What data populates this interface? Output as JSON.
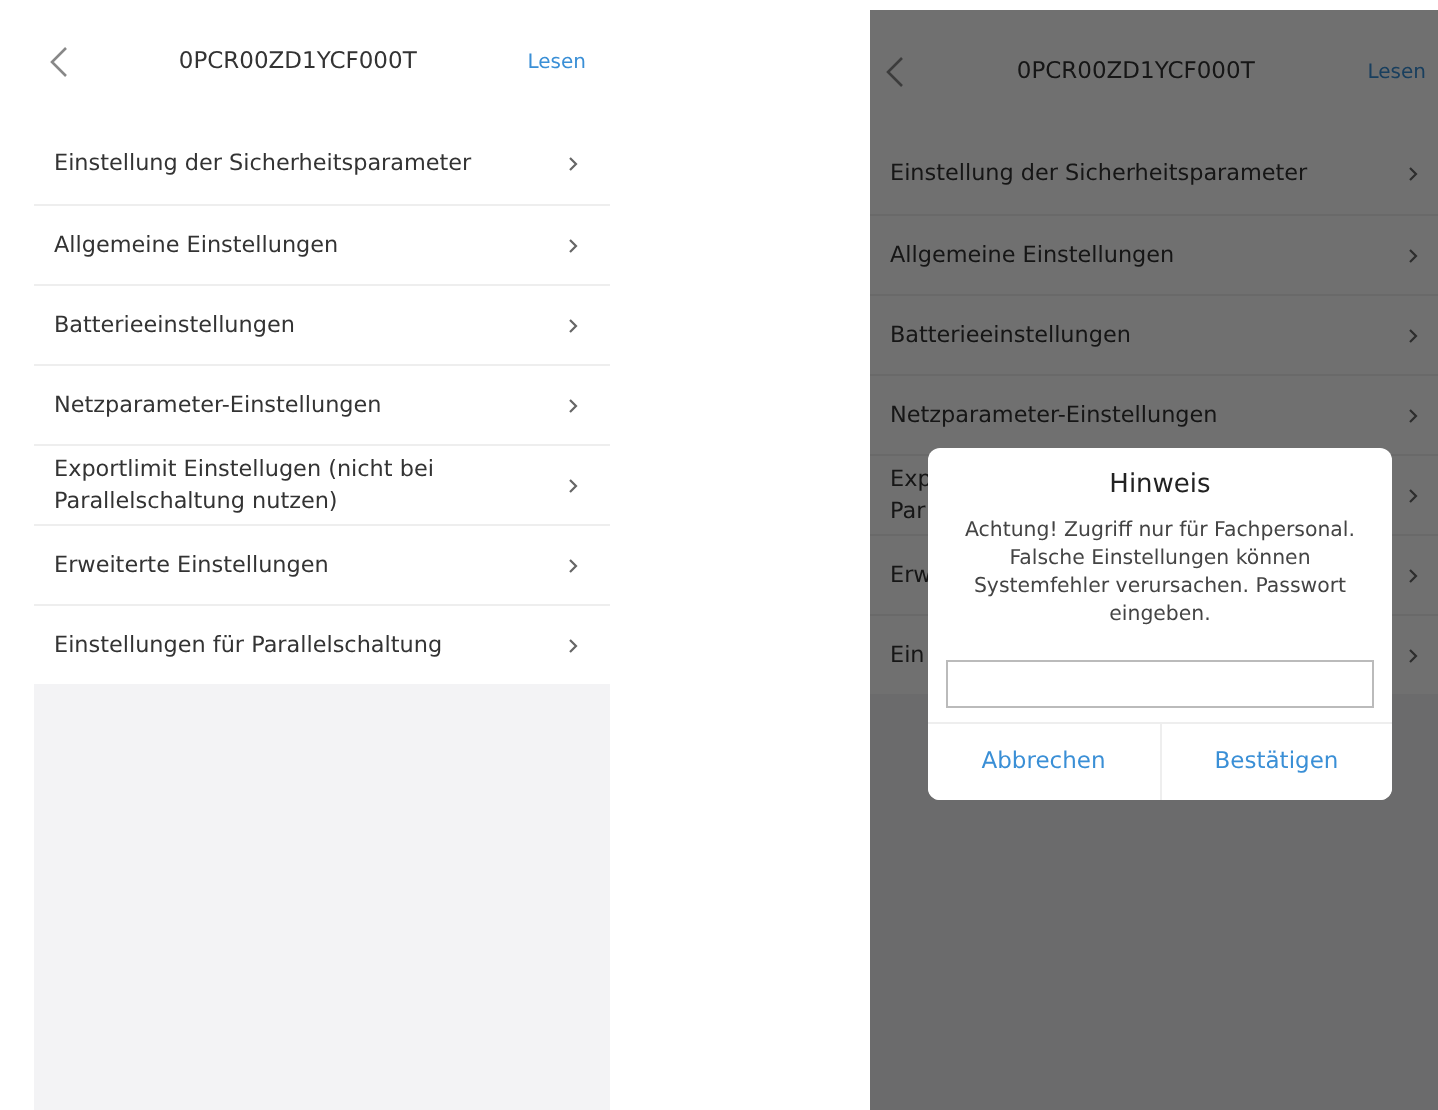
{
  "screens": [
    {
      "header": {
        "title": "0PCR00ZD1YCF000T",
        "action": "Lesen"
      },
      "items": [
        {
          "lines": [
            "Einstellung der Sicherheitsparameter"
          ]
        },
        {
          "lines": [
            "Allgemeine Einstellungen"
          ]
        },
        {
          "lines": [
            "Batterieeinstellungen"
          ]
        },
        {
          "lines": [
            "Netzparameter-Einstellungen"
          ]
        },
        {
          "lines": [
            "Exportlimit Einstellugen (nicht bei",
            "Parallelschaltung nutzen)"
          ]
        },
        {
          "lines": [
            "Erweiterte Einstellungen"
          ]
        },
        {
          "lines": [
            "Einstellungen für Parallelschaltung"
          ]
        }
      ]
    },
    {
      "header": {
        "title": "0PCR00ZD1YCF000T",
        "action": "Lesen"
      },
      "items": [
        {
          "lines": [
            "Einstellung der Sicherheitsparameter"
          ]
        },
        {
          "lines": [
            "Allgemeine Einstellungen"
          ]
        },
        {
          "lines": [
            "Batterieeinstellungen"
          ]
        },
        {
          "lines": [
            "Netzparameter-Einstellungen"
          ]
        },
        {
          "lines": [
            "Exp",
            "Par"
          ]
        },
        {
          "lines": [
            "Erw"
          ]
        },
        {
          "lines": [
            "Ein"
          ]
        }
      ],
      "dialog": {
        "title": "Hinweis",
        "message": "Achtung! Zugriff nur für Fachpersonal. Falsche Einstellungen können Systemfehler verursachen. Passwort eingeben.",
        "buttons": [
          "Abbrechen",
          "Bestätigen"
        ]
      }
    }
  ]
}
